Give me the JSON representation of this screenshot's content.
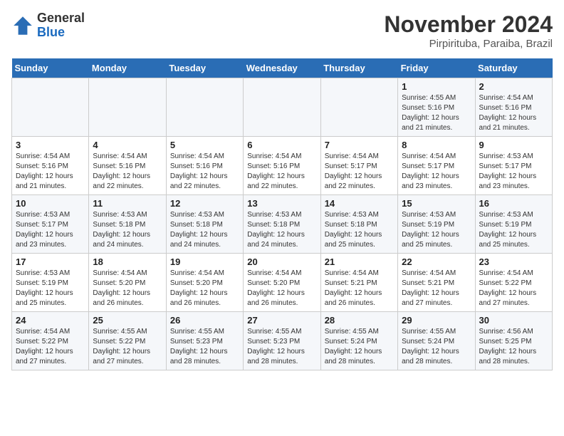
{
  "header": {
    "logo_line1": "General",
    "logo_line2": "Blue",
    "month": "November 2024",
    "location": "Pirpirituba, Paraiba, Brazil"
  },
  "weekdays": [
    "Sunday",
    "Monday",
    "Tuesday",
    "Wednesday",
    "Thursday",
    "Friday",
    "Saturday"
  ],
  "weeks": [
    [
      {
        "day": "",
        "info": ""
      },
      {
        "day": "",
        "info": ""
      },
      {
        "day": "",
        "info": ""
      },
      {
        "day": "",
        "info": ""
      },
      {
        "day": "",
        "info": ""
      },
      {
        "day": "1",
        "info": "Sunrise: 4:55 AM\nSunset: 5:16 PM\nDaylight: 12 hours and 21 minutes."
      },
      {
        "day": "2",
        "info": "Sunrise: 4:54 AM\nSunset: 5:16 PM\nDaylight: 12 hours and 21 minutes."
      }
    ],
    [
      {
        "day": "3",
        "info": "Sunrise: 4:54 AM\nSunset: 5:16 PM\nDaylight: 12 hours and 21 minutes."
      },
      {
        "day": "4",
        "info": "Sunrise: 4:54 AM\nSunset: 5:16 PM\nDaylight: 12 hours and 22 minutes."
      },
      {
        "day": "5",
        "info": "Sunrise: 4:54 AM\nSunset: 5:16 PM\nDaylight: 12 hours and 22 minutes."
      },
      {
        "day": "6",
        "info": "Sunrise: 4:54 AM\nSunset: 5:16 PM\nDaylight: 12 hours and 22 minutes."
      },
      {
        "day": "7",
        "info": "Sunrise: 4:54 AM\nSunset: 5:17 PM\nDaylight: 12 hours and 22 minutes."
      },
      {
        "day": "8",
        "info": "Sunrise: 4:54 AM\nSunset: 5:17 PM\nDaylight: 12 hours and 23 minutes."
      },
      {
        "day": "9",
        "info": "Sunrise: 4:53 AM\nSunset: 5:17 PM\nDaylight: 12 hours and 23 minutes."
      }
    ],
    [
      {
        "day": "10",
        "info": "Sunrise: 4:53 AM\nSunset: 5:17 PM\nDaylight: 12 hours and 23 minutes."
      },
      {
        "day": "11",
        "info": "Sunrise: 4:53 AM\nSunset: 5:18 PM\nDaylight: 12 hours and 24 minutes."
      },
      {
        "day": "12",
        "info": "Sunrise: 4:53 AM\nSunset: 5:18 PM\nDaylight: 12 hours and 24 minutes."
      },
      {
        "day": "13",
        "info": "Sunrise: 4:53 AM\nSunset: 5:18 PM\nDaylight: 12 hours and 24 minutes."
      },
      {
        "day": "14",
        "info": "Sunrise: 4:53 AM\nSunset: 5:18 PM\nDaylight: 12 hours and 25 minutes."
      },
      {
        "day": "15",
        "info": "Sunrise: 4:53 AM\nSunset: 5:19 PM\nDaylight: 12 hours and 25 minutes."
      },
      {
        "day": "16",
        "info": "Sunrise: 4:53 AM\nSunset: 5:19 PM\nDaylight: 12 hours and 25 minutes."
      }
    ],
    [
      {
        "day": "17",
        "info": "Sunrise: 4:53 AM\nSunset: 5:19 PM\nDaylight: 12 hours and 25 minutes."
      },
      {
        "day": "18",
        "info": "Sunrise: 4:54 AM\nSunset: 5:20 PM\nDaylight: 12 hours and 26 minutes."
      },
      {
        "day": "19",
        "info": "Sunrise: 4:54 AM\nSunset: 5:20 PM\nDaylight: 12 hours and 26 minutes."
      },
      {
        "day": "20",
        "info": "Sunrise: 4:54 AM\nSunset: 5:20 PM\nDaylight: 12 hours and 26 minutes."
      },
      {
        "day": "21",
        "info": "Sunrise: 4:54 AM\nSunset: 5:21 PM\nDaylight: 12 hours and 26 minutes."
      },
      {
        "day": "22",
        "info": "Sunrise: 4:54 AM\nSunset: 5:21 PM\nDaylight: 12 hours and 27 minutes."
      },
      {
        "day": "23",
        "info": "Sunrise: 4:54 AM\nSunset: 5:22 PM\nDaylight: 12 hours and 27 minutes."
      }
    ],
    [
      {
        "day": "24",
        "info": "Sunrise: 4:54 AM\nSunset: 5:22 PM\nDaylight: 12 hours and 27 minutes."
      },
      {
        "day": "25",
        "info": "Sunrise: 4:55 AM\nSunset: 5:22 PM\nDaylight: 12 hours and 27 minutes."
      },
      {
        "day": "26",
        "info": "Sunrise: 4:55 AM\nSunset: 5:23 PM\nDaylight: 12 hours and 28 minutes."
      },
      {
        "day": "27",
        "info": "Sunrise: 4:55 AM\nSunset: 5:23 PM\nDaylight: 12 hours and 28 minutes."
      },
      {
        "day": "28",
        "info": "Sunrise: 4:55 AM\nSunset: 5:24 PM\nDaylight: 12 hours and 28 minutes."
      },
      {
        "day": "29",
        "info": "Sunrise: 4:55 AM\nSunset: 5:24 PM\nDaylight: 12 hours and 28 minutes."
      },
      {
        "day": "30",
        "info": "Sunrise: 4:56 AM\nSunset: 5:25 PM\nDaylight: 12 hours and 28 minutes."
      }
    ]
  ]
}
